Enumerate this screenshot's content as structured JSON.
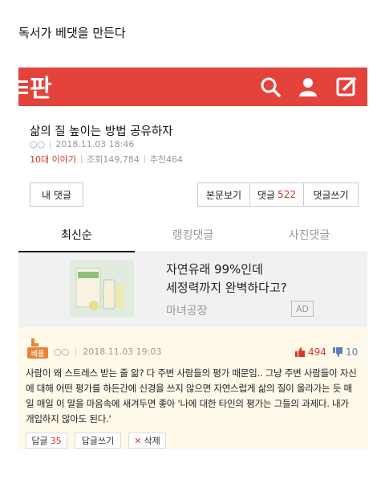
{
  "caption": "독서가 베댓을 만든다",
  "colors": {
    "brand": "#e3433b",
    "accent_red": "#d8382f",
    "dislike_blue": "#5a7fbf"
  },
  "header": {
    "logo_text": "판",
    "icons": [
      "search-icon",
      "user-icon",
      "write-icon"
    ]
  },
  "post": {
    "title": "삶의 질 높이는 방법 공유하자",
    "author": "○○",
    "datetime": "2018.11.03 18:46",
    "category": "10대 이야기",
    "views": "조회149,784",
    "recommend": "추천464"
  },
  "actions": {
    "my_comments": "내 댓글",
    "view_original": "본문보기",
    "comments_label": "댓글",
    "comments_count": "522",
    "write_comment": "댓글쓰기"
  },
  "tabs": [
    {
      "label": "최신순",
      "active": true
    },
    {
      "label": "랭킹댓글",
      "active": false
    },
    {
      "label": "사진댓글",
      "active": false
    }
  ],
  "ad": {
    "line1": "자연유래 99%인데",
    "line2": "세정력까지 완벽하다고?",
    "brand": "마녀공장",
    "badge": "AD"
  },
  "comment": {
    "badge": "베플",
    "author": "○○",
    "datetime": "2018.11.03 19:03",
    "likes": "494",
    "dislikes": "10",
    "body": "사람이 왜 스트레스 받는 줄 앎? 다 주변 사람들의 평가 때문임.. 그냥 주변 사람들이 자신에 대해 어떤 평가를 하든간에 신경을 쓰지 않으면 자연스럽게 삶의 질이 올라가는 듯 매일 매일 이 말을 마음속에 새겨두면 좋아 '나에 대한 타인의 평가는 그들의 과제다. 내가 개입하지 않아도 된다.'",
    "reply_label": "답글",
    "reply_count": "35",
    "write_reply": "답글쓰기",
    "delete": "삭제"
  }
}
